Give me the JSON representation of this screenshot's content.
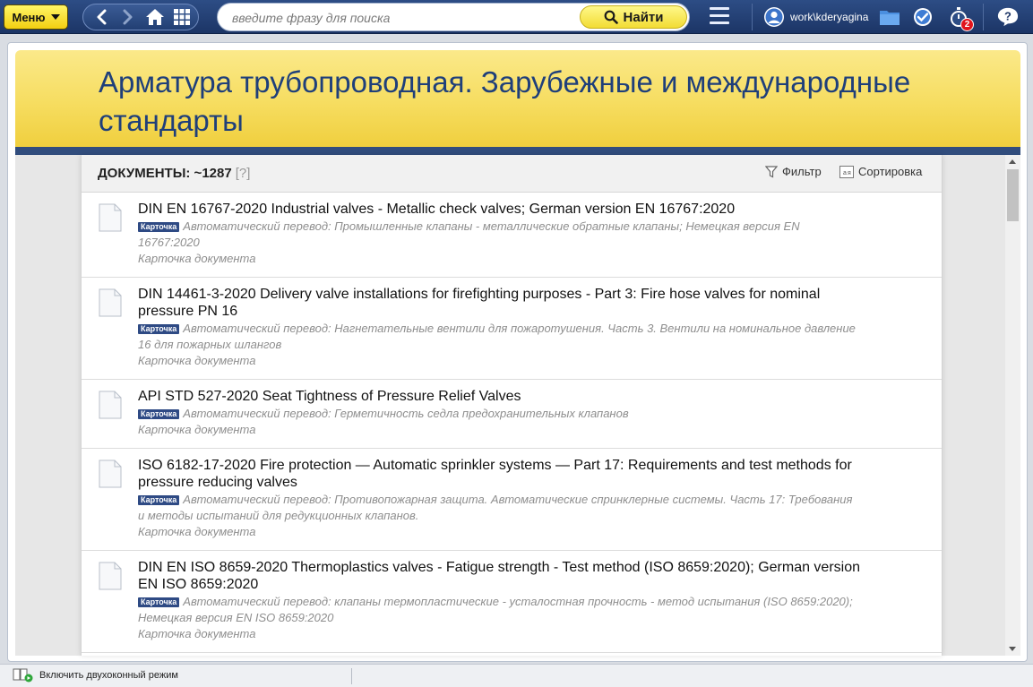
{
  "toolbar": {
    "menu_label": "Меню",
    "search_placeholder": "введите фразу для поиска",
    "search_button": "Найти",
    "username": "work\\kderyagina",
    "timer_badge": "2",
    "icons": [
      "back-icon",
      "forward-icon",
      "home-icon",
      "grid-icon",
      "search-icon",
      "hamburger-icon",
      "user-icon",
      "folder-icon",
      "clock-check-icon",
      "stopwatch-icon",
      "help-icon"
    ]
  },
  "header": {
    "title": "Арматура трубопроводная. Зарубежные и международные стандарты"
  },
  "documents": {
    "count_label": "ДОКУМЕНТЫ: ~1287",
    "help_label": "[?]",
    "filter_label": "Фильтр",
    "sort_label": "Сортировка",
    "items": [
      {
        "title": "DIN EN 16767-2020 Industrial valves - Metallic check valves; German version EN 16767:2020",
        "badge": "Карточка",
        "translation": "Автоматический перевод: Промышленные клапаны - металлические обратные клапаны; Немецкая версия EN 16767:2020",
        "link": "Карточка документа"
      },
      {
        "title": "DIN 14461-3-2020 Delivery valve installations for firefighting purposes - Part 3: Fire hose valves for nominal pressure PN 16",
        "badge": "Карточка",
        "translation": "Автоматический перевод: Нагнетательные вентили для пожаротушения. Часть 3. Вентили на номинальное давление 16 для пожарных шлангов",
        "link": "Карточка документа"
      },
      {
        "title": "API STD 527-2020 Seat Tightness of Pressure Relief Valves",
        "badge": "Карточка",
        "translation": "Автоматический перевод: Герметичность седла предохранительных клапанов",
        "link": "Карточка документа"
      },
      {
        "title": "ISO 6182-17-2020 Fire protection — Automatic sprinkler systems — Part 17: Requirements and test methods for pressure reducing valves",
        "badge": "Карточка",
        "translation": "Автоматический перевод: Противопожарная защита. Автоматические спринклерные системы. Часть 17: Требования и методы испытаний для редукционных клапанов.",
        "link": "Карточка документа"
      },
      {
        "title": "DIN EN ISO 8659-2020 Thermoplastics valves - Fatigue strength - Test method (ISO 8659:2020); German version EN ISO 8659:2020",
        "badge": "Карточка",
        "translation": "Автоматический перевод: клапаны термопластические - усталостная прочность - метод испытания (ISO 8659:2020); Немецкая версия EN ISO 8659:2020",
        "link": "Карточка документа"
      }
    ]
  },
  "statusbar": {
    "dual_mode_label": "Включить двухоконный режим"
  },
  "colors": {
    "toolbar_blue": "#1c3566",
    "header_yellow": "#f6dd60",
    "title_blue": "#1f3f7a",
    "badge_blue": "#2e4a84",
    "notification_red": "#e1141b"
  }
}
